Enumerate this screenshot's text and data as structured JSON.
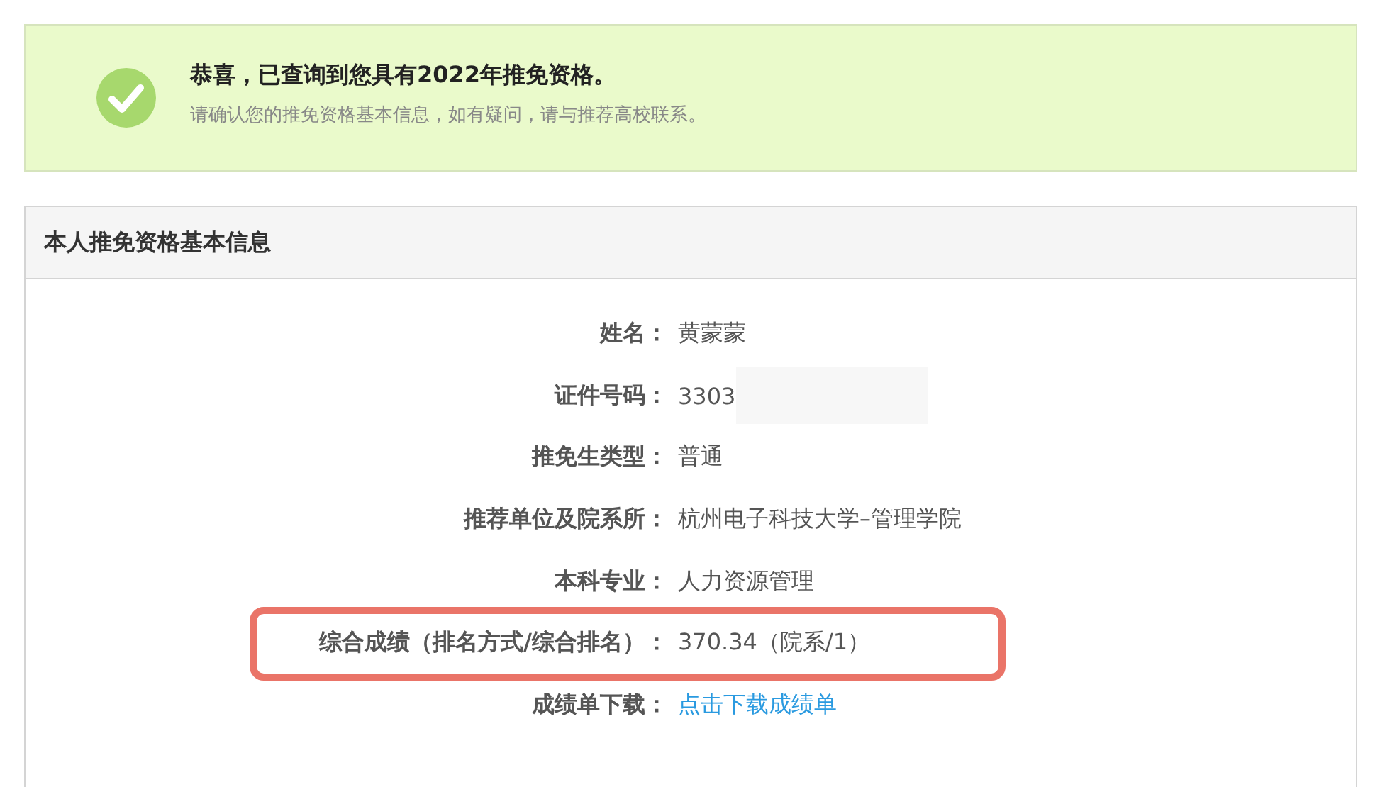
{
  "notice": {
    "title": "恭喜，已查询到您具有2022年推免资格。",
    "message": "请确认您的推免资格基本信息，如有疑问，请与推荐高校联系。"
  },
  "panel": {
    "title": "本人推免资格基本信息",
    "rows": [
      {
        "label": "姓名：",
        "value": "黄蒙蒙",
        "kind": "text",
        "redacted": false,
        "highlighted": false
      },
      {
        "label": "证件号码：",
        "value": "3303",
        "kind": "text",
        "redacted": true,
        "highlighted": false
      },
      {
        "label": "推免生类型：",
        "value": "普通",
        "kind": "text",
        "redacted": false,
        "highlighted": false
      },
      {
        "label": "推荐单位及院系所：",
        "value": "杭州电子科技大学–管理学院",
        "kind": "text",
        "redacted": false,
        "highlighted": false
      },
      {
        "label": "本科专业：",
        "value": "人力资源管理",
        "kind": "text",
        "redacted": false,
        "highlighted": false
      },
      {
        "label": "综合成绩（排名方式/综合排名）：",
        "value": "370.34（院系/1）",
        "kind": "text",
        "redacted": false,
        "highlighted": true
      },
      {
        "label": "成绩单下载：",
        "value": "点击下载成绩单",
        "kind": "link",
        "redacted": false,
        "highlighted": false
      }
    ]
  }
}
